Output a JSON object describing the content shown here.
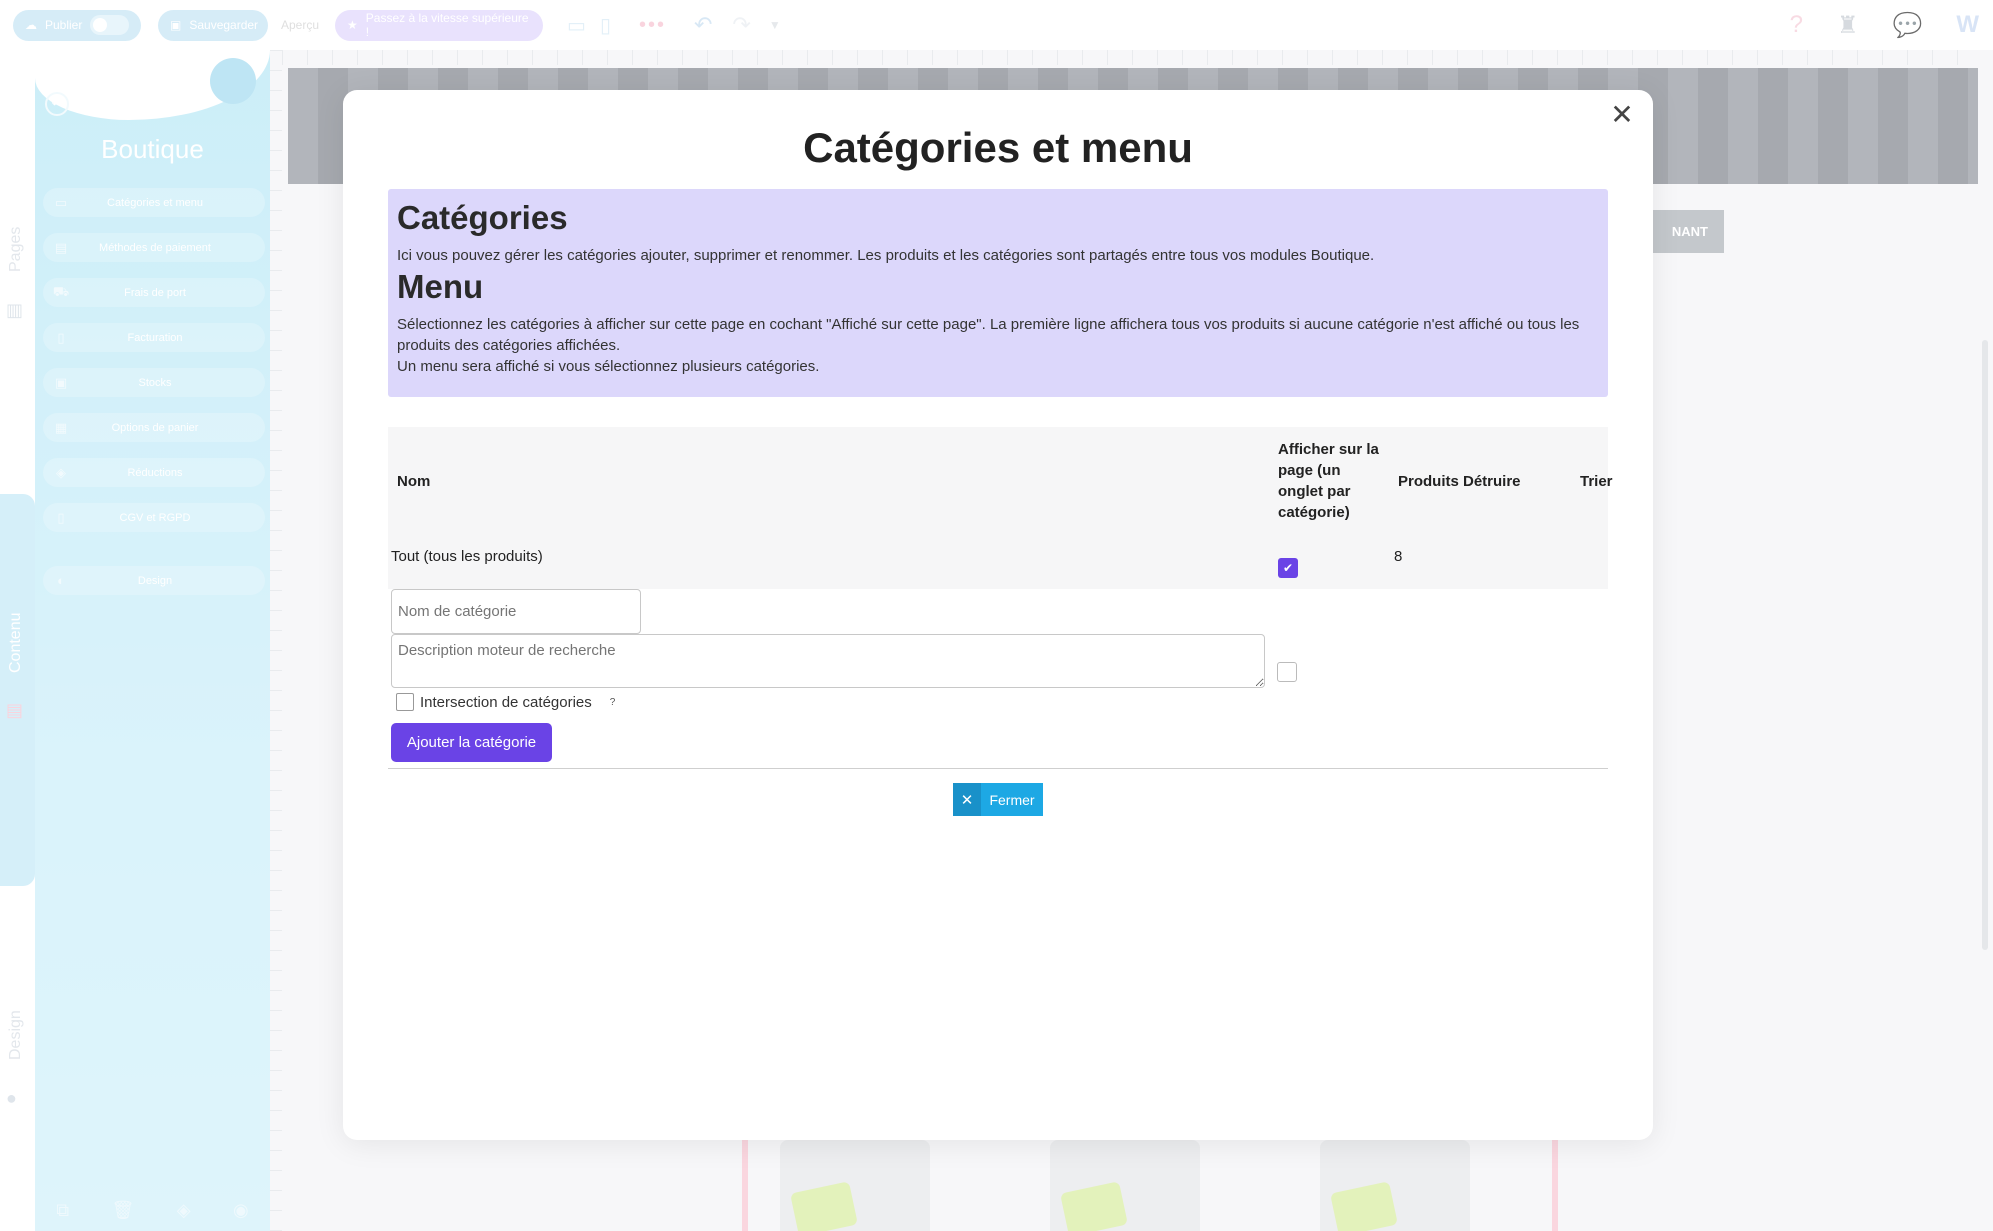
{
  "toolbar": {
    "publish_label": "Publier",
    "save_label": "Sauvegarder",
    "preview_label": "Aperçu",
    "upgrade_label": "Passez à la vitesse supérieure !",
    "dots": "•••"
  },
  "rail": {
    "pages_label": "Pages",
    "content_label": "Contenu",
    "design_label": "Design"
  },
  "panel": {
    "title": "Boutique",
    "items": [
      {
        "label": "Catégories et menu",
        "icon": "folder-icon"
      },
      {
        "label": "Méthodes de paiement",
        "icon": "card-icon"
      },
      {
        "label": "Frais de port",
        "icon": "truck-icon"
      },
      {
        "label": "Facturation",
        "icon": "invoice-icon"
      },
      {
        "label": "Stocks",
        "icon": "box-icon"
      },
      {
        "label": "Options de panier",
        "icon": "grid-icon"
      },
      {
        "label": "Réductions",
        "icon": "tag-icon"
      },
      {
        "label": "CGV et RGPD",
        "icon": "document-icon"
      },
      {
        "label": "Design",
        "icon": "palette-icon"
      }
    ]
  },
  "canvas": {
    "button_text": "NANT"
  },
  "modal": {
    "title": "Catégories et menu",
    "categories_heading": "Catégories",
    "categories_text": "Ici vous pouvez gérer les catégories ajouter, supprimer et renommer. Les produits et les catégories sont partagés entre tous vos modules Boutique.",
    "menu_heading": "Menu",
    "menu_text_1": "Sélectionnez les catégories à afficher sur cette page en cochant \"Affiché sur cette page\". La première ligne affichera tous vos produits si aucune catégorie n'est affiché ou tous les produits des catégories affichées.",
    "menu_text_2": "Un menu sera affiché si vous sélectionnez plusieurs catégories.",
    "table": {
      "headers": {
        "name": "Nom",
        "show": "Afficher sur la page (un onglet par catégorie)",
        "products_destroy": "Produits Détruire",
        "sort": "Trier"
      },
      "rows": [
        {
          "name": "Tout (tous les produits)",
          "shown": true,
          "products": "8"
        }
      ]
    },
    "new_category": {
      "name_placeholder": "Nom de catégorie",
      "description_placeholder": "Description moteur de recherche",
      "intersection_label": "Intersection de catégories",
      "help": "?",
      "add_button": "Ajouter la catégorie"
    },
    "close_button": "Fermer"
  },
  "colors": {
    "accent": "#6a43e6",
    "close_blue": "#1da8e4",
    "info_bg": "#dcd7fb",
    "panel_bg": "#a8e2f3"
  }
}
